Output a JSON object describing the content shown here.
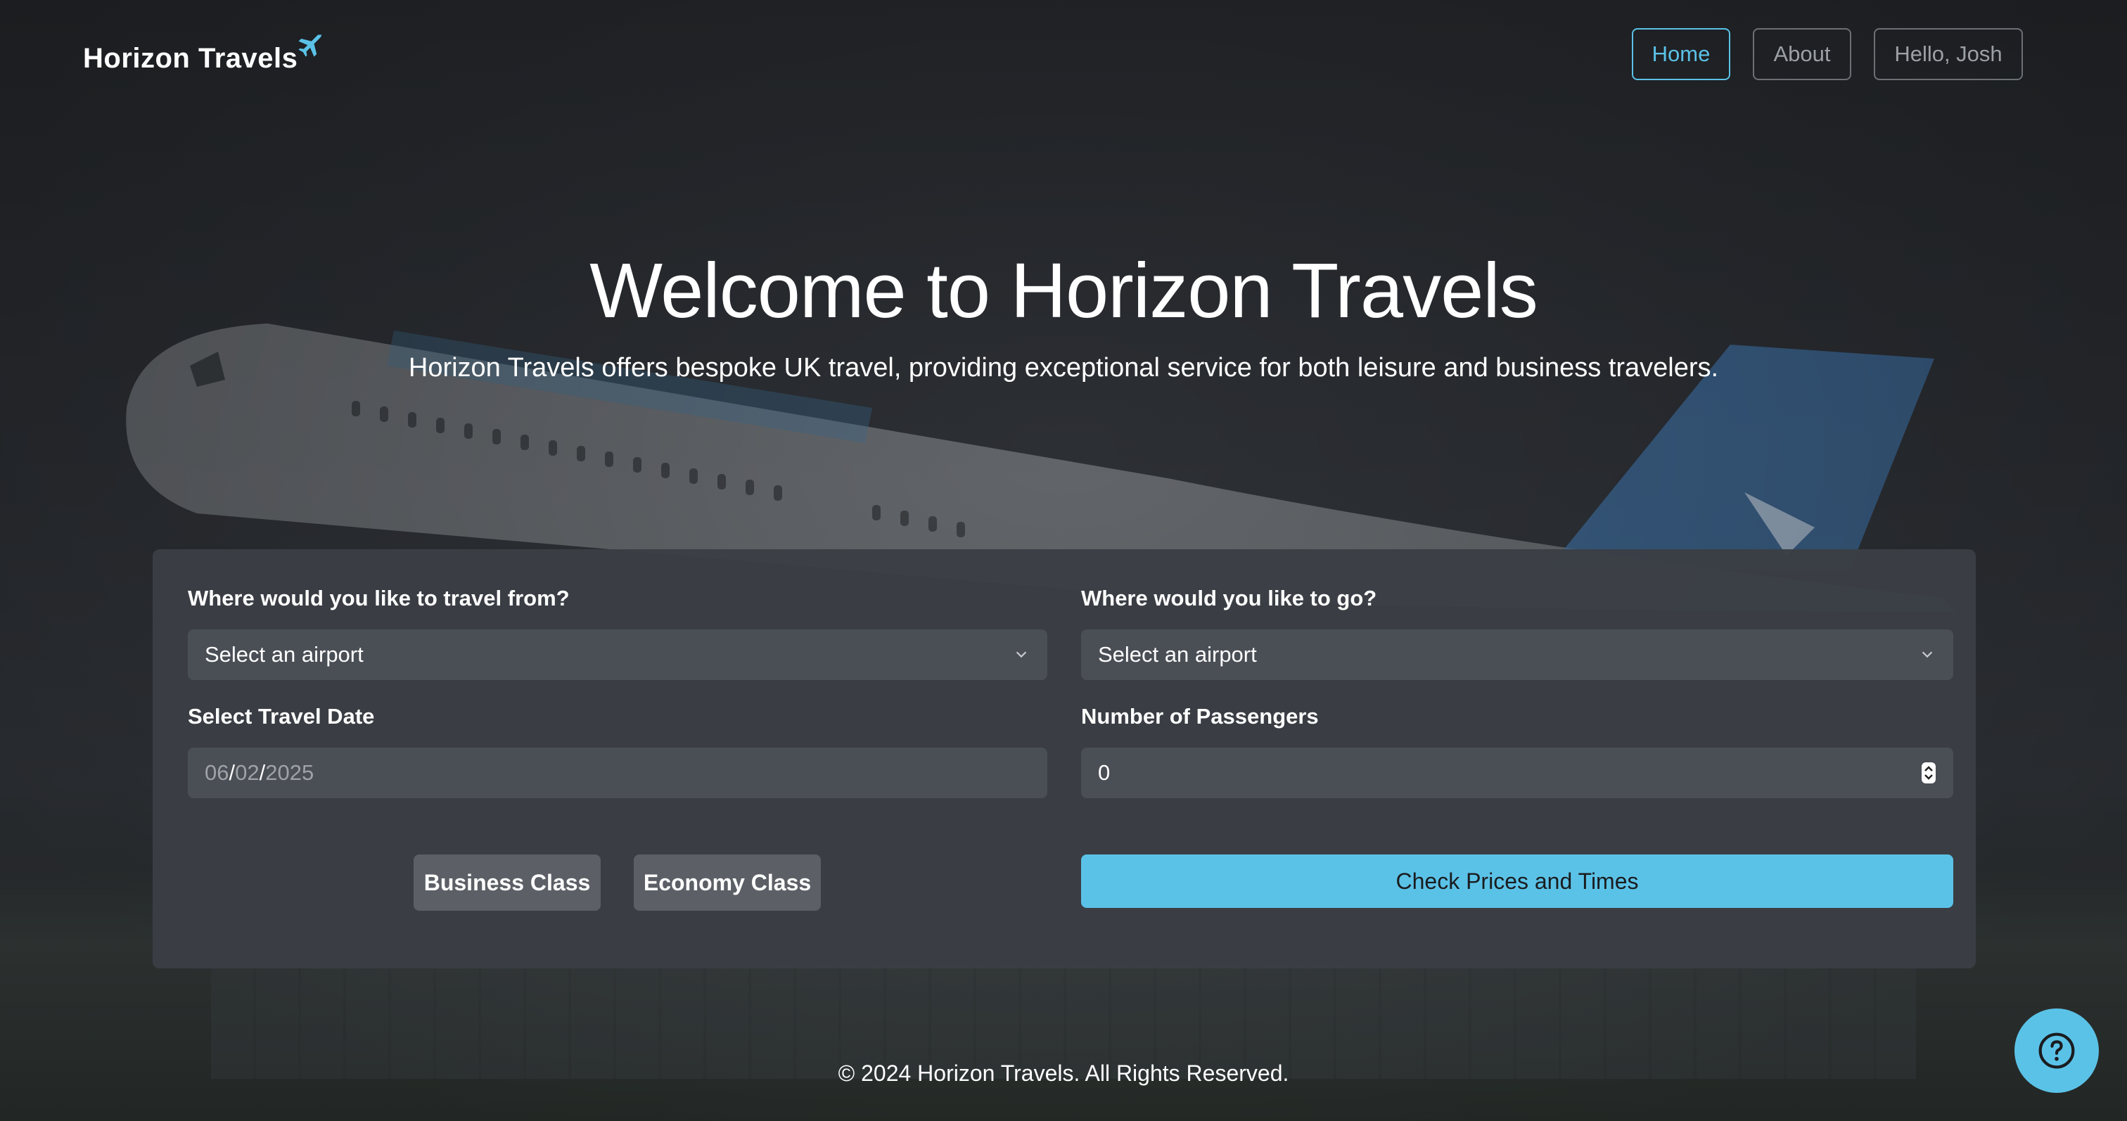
{
  "brand": {
    "name": "Horizon Travels",
    "icon": "airplane-icon"
  },
  "nav": {
    "home_label": "Home",
    "about_label": "About",
    "user_label": "Hello, Josh"
  },
  "hero": {
    "title": "Welcome to Horizon Travels",
    "subtitle": "Horizon Travels offers bespoke UK travel, providing exceptional service for both leisure and business travelers."
  },
  "form": {
    "from": {
      "label": "Where would you like to travel from?",
      "value": "Select an airport"
    },
    "to": {
      "label": "Where would you like to go?",
      "value": "Select an airport"
    },
    "date": {
      "label": "Select Travel Date",
      "month": "06",
      "day": "02",
      "year": "2025"
    },
    "passengers": {
      "label": "Number of Passengers",
      "value": "0"
    },
    "business_label": "Business Class",
    "economy_label": "Economy Class",
    "submit_label": "Check Prices and Times"
  },
  "footer": {
    "text": "© 2024 Horizon Travels. All Rights Reserved."
  },
  "help": {
    "icon": "question-icon"
  },
  "colors": {
    "accent": "#5bc2e7",
    "card": "#3b3f45",
    "field": "#4a4e55"
  }
}
